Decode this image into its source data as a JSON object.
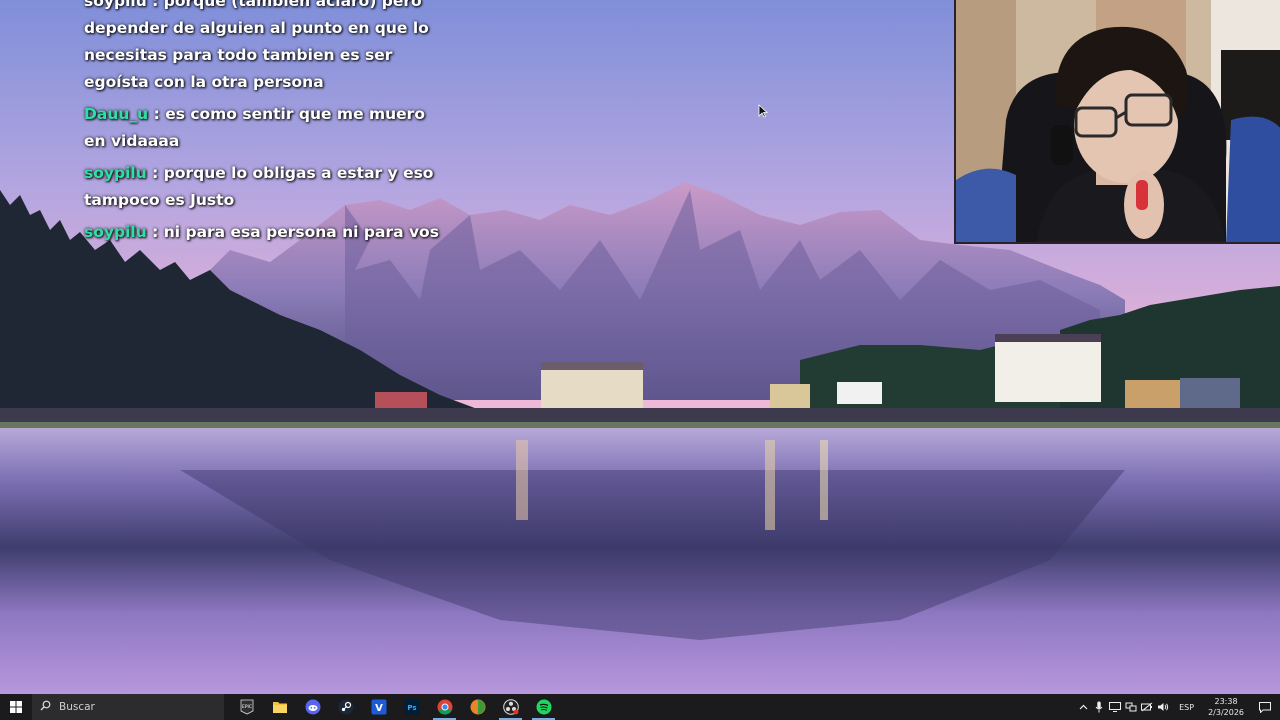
{
  "chat": {
    "messages": [
      {
        "user": "",
        "sep": "",
        "text": "soypilu : porque (tambien aclaro) pero depender de alguien al punto en que lo necesitas para todo tambien es ser egoísta con la otra persona"
      },
      {
        "user": "Dauu_u",
        "sep": " : ",
        "text": "es como sentir que me muero en vidaaaa"
      },
      {
        "user": "soypilu",
        "sep": " : ",
        "text": "porque lo obligas a estar y eso tampoco es Justo"
      },
      {
        "user": "soypilu",
        "sep": " : ",
        "text": "ni para esa persona ni para vos"
      }
    ],
    "username_color": "#2fe0a6"
  },
  "taskbar": {
    "search_placeholder": "Buscar",
    "apps": [
      {
        "name": "epic-games-icon",
        "label": "EPIC"
      },
      {
        "name": "file-explorer-icon",
        "label": ""
      },
      {
        "name": "discord-icon",
        "label": ""
      },
      {
        "name": "steam-icon",
        "label": ""
      },
      {
        "name": "vegas-icon",
        "label": "V"
      },
      {
        "name": "photoshop-icon",
        "label": "Ps"
      },
      {
        "name": "chrome-icon",
        "label": ""
      },
      {
        "name": "green-app-icon",
        "label": ""
      },
      {
        "name": "obs-icon",
        "label": ""
      },
      {
        "name": "spotify-icon",
        "label": ""
      }
    ],
    "language": "ESP",
    "time": "23:38",
    "date": "2/3/2026"
  },
  "colors": {
    "taskbar_bg": "#1b1b1d",
    "sky_top": "#8a8fd8",
    "sky_pink": "#e6b6dc",
    "lake": "#8c7fc8"
  }
}
